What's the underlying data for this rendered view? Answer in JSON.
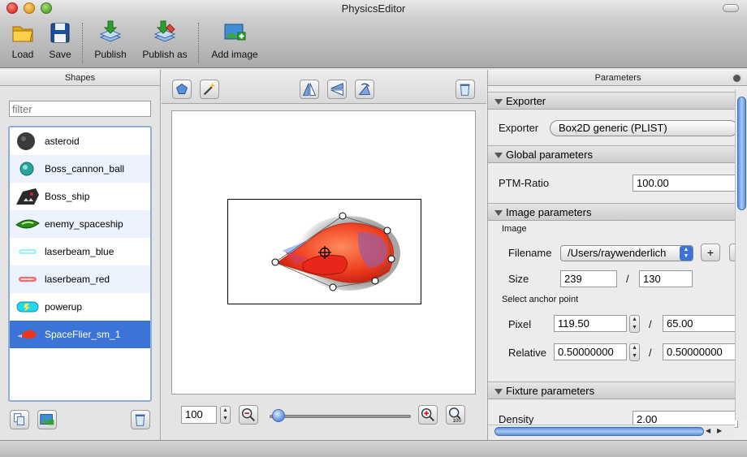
{
  "window": {
    "title": "PhysicsEditor"
  },
  "toolbar": {
    "buttons": [
      {
        "label": "Load",
        "icon": "folder-icon"
      },
      {
        "label": "Save",
        "icon": "floppy-disk-icon"
      },
      {
        "label": "Publish",
        "icon": "publish-icon"
      },
      {
        "label": "Publish as",
        "icon": "publish-as-icon"
      },
      {
        "label": "Add image",
        "icon": "add-image-icon"
      }
    ]
  },
  "shapes_panel": {
    "title": "Shapes",
    "filter_placeholder": "filter",
    "items": [
      {
        "label": "asteroid",
        "icon": "asteroid-thumb"
      },
      {
        "label": "Boss_cannon_ball",
        "icon": "cannon-ball-thumb"
      },
      {
        "label": "Boss_ship",
        "icon": "boss-ship-thumb"
      },
      {
        "label": "enemy_spaceship",
        "icon": "enemy-spaceship-thumb"
      },
      {
        "label": "laserbeam_blue",
        "icon": "laser-blue-thumb"
      },
      {
        "label": "laserbeam_red",
        "icon": "laser-red-thumb"
      },
      {
        "label": "powerup",
        "icon": "powerup-thumb"
      },
      {
        "label": "SpaceFlier_sm_1",
        "icon": "spaceflier-thumb",
        "selected": true
      }
    ]
  },
  "editor": {
    "zoom_value": "100"
  },
  "parameters_panel": {
    "title": "Parameters",
    "exporter": {
      "section": "Exporter",
      "label": "Exporter",
      "value": "Box2D generic (PLIST)"
    },
    "global": {
      "section": "Global parameters",
      "ptm_label": "PTM-Ratio",
      "ptm_value": "100.00"
    },
    "image": {
      "section": "Image parameters",
      "subheading": "Image",
      "filename_label": "Filename",
      "filename_value": "/Users/raywenderlich",
      "add_label": "+",
      "size_label": "Size",
      "width": "239",
      "slash": "/",
      "height": "130",
      "anchor_heading": "Select anchor point",
      "pixel_label": "Pixel",
      "pixel_x": "119.50",
      "pixel_y": "65.00",
      "relative_label": "Relative",
      "relative_x": "0.50000000",
      "relative_y": "0.50000000"
    },
    "fixture": {
      "section": "Fixture parameters",
      "density_label": "Density",
      "density_value": "2.00"
    }
  },
  "colors": {
    "selection": "#3b74d6",
    "scroll_thumb": "#5e90d9",
    "ship_red": "#e8361f"
  }
}
